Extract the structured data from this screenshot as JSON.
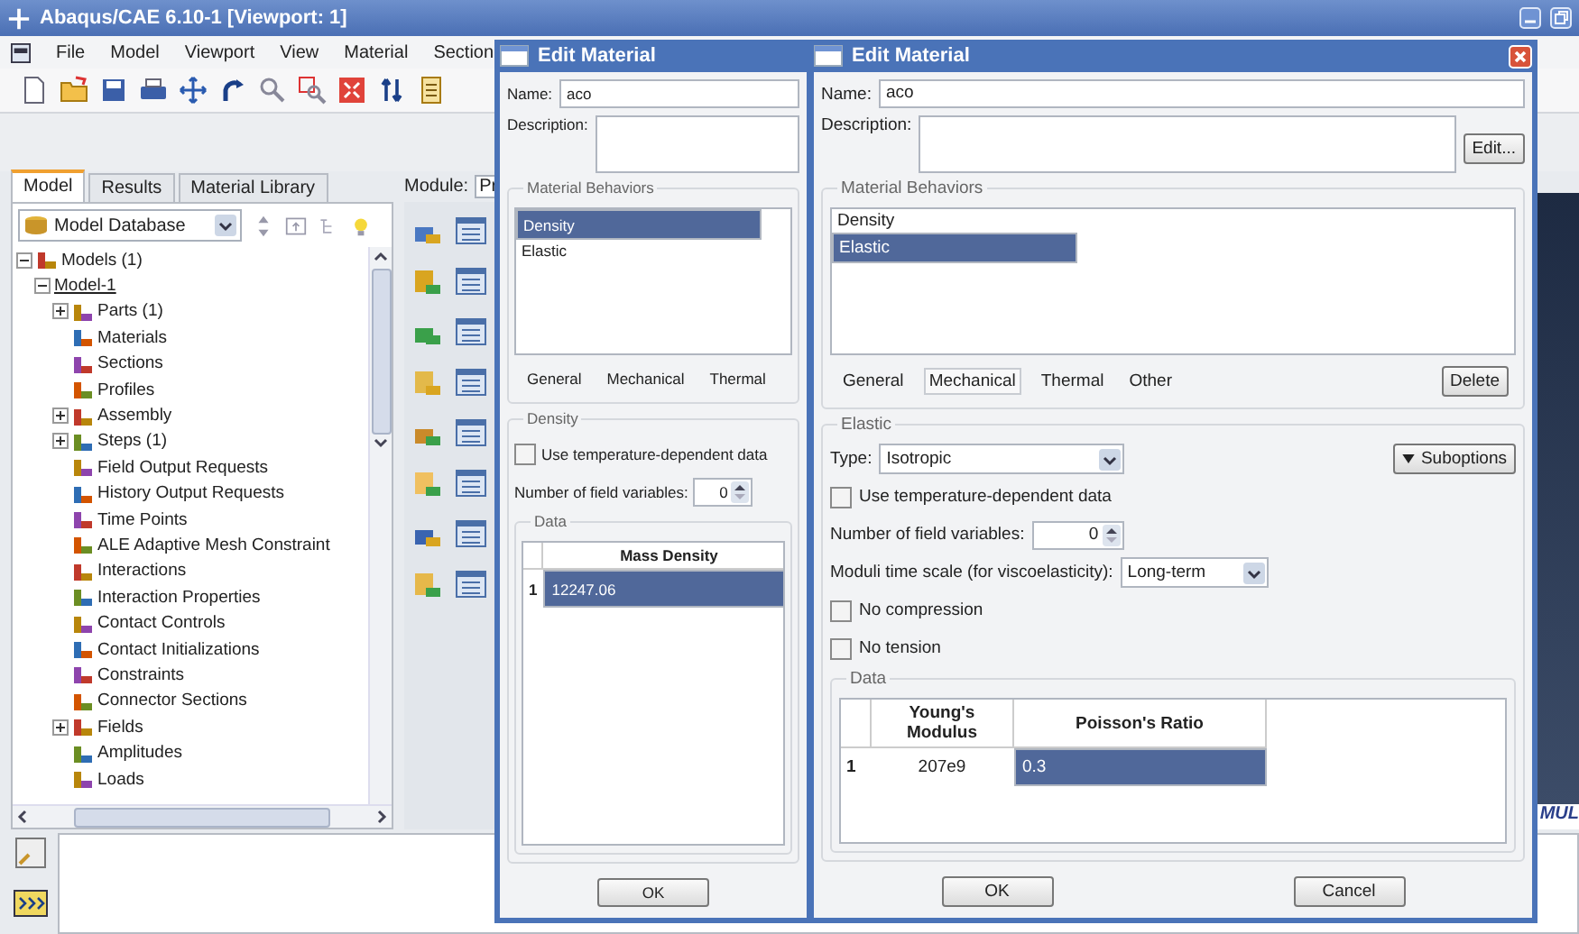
{
  "main_window": {
    "title": "Abaqus/CAE 6.10-1 [Viewport: 1]"
  },
  "menu": [
    "File",
    "Model",
    "Viewport",
    "View",
    "Material",
    "Section"
  ],
  "tabs": [
    {
      "label": "Model",
      "selected": true
    },
    {
      "label": "Results",
      "selected": false
    },
    {
      "label": "Material Library",
      "selected": false
    }
  ],
  "database_select": {
    "value": "Model Database"
  },
  "module": {
    "label": "Module:",
    "value": "Pr"
  },
  "tree": [
    {
      "label": "Models (1)",
      "expanded": true,
      "children": [
        {
          "label": "Model-1",
          "expanded": true,
          "children": [
            {
              "label": "Parts (1)",
              "expanded": false
            },
            {
              "label": "Materials"
            },
            {
              "label": "Sections"
            },
            {
              "label": "Profiles"
            },
            {
              "label": "Assembly",
              "expanded": false
            },
            {
              "label": "Steps (1)",
              "expanded": false
            },
            {
              "label": "Field Output Requests"
            },
            {
              "label": "History Output Requests"
            },
            {
              "label": "Time Points"
            },
            {
              "label": "ALE Adaptive Mesh Constraint"
            },
            {
              "label": "Interactions"
            },
            {
              "label": "Interaction Properties"
            },
            {
              "label": "Contact Controls"
            },
            {
              "label": "Contact Initializations"
            },
            {
              "label": "Constraints"
            },
            {
              "label": "Connector Sections"
            },
            {
              "label": "Fields",
              "expanded": false
            },
            {
              "label": "Amplitudes"
            },
            {
              "label": "Loads"
            }
          ]
        }
      ]
    }
  ],
  "viewport": {
    "logo_text": "MUL"
  },
  "dialogs": [
    {
      "title": "Edit Material",
      "name_label": "Name:",
      "name": "aco",
      "description_label": "Description:",
      "behaviors_title": "Material Behaviors",
      "behaviors": [
        {
          "label": "Density",
          "selected": true
        },
        {
          "label": "Elastic",
          "selected": false
        }
      ],
      "behavior_tabs": [
        {
          "label": "General",
          "selected": false
        },
        {
          "label": "Mechanical",
          "selected": false
        },
        {
          "label": "Thermal",
          "selected": false
        }
      ],
      "section_title": "Density",
      "options": [
        {
          "kind": "checkbox",
          "label": "Use temperature-dependent data",
          "checked": false
        },
        {
          "kind": "spinner",
          "label": "Number of field variables:",
          "value": "0"
        }
      ],
      "data_title": "Data",
      "table": {
        "columns": [
          "Mass Density"
        ],
        "rows": [
          {
            "index": "1",
            "cells": [
              {
                "text": "12247.06",
                "selected": true
              }
            ]
          }
        ]
      },
      "buttons": [
        "OK"
      ]
    },
    {
      "title": "Edit Material",
      "name_label": "Name:",
      "name": "aco",
      "description_label": "Description:",
      "edit_button": "Edit...",
      "behaviors_title": "Material Behaviors",
      "behaviors": [
        {
          "label": "Density",
          "selected": false
        },
        {
          "label": "Elastic",
          "selected": true
        }
      ],
      "behavior_tabs": [
        {
          "label": "General",
          "selected": false
        },
        {
          "label": "Mechanical",
          "selected": true
        },
        {
          "label": "Thermal",
          "selected": false
        },
        {
          "label": "Other",
          "selected": false
        }
      ],
      "delete_button": "Delete",
      "section_title": "Elastic",
      "options": [
        {
          "kind": "select",
          "label": "Type:",
          "value": "Isotropic",
          "button": "Suboptions"
        },
        {
          "kind": "checkbox",
          "label": "Use temperature-dependent data",
          "checked": false
        },
        {
          "kind": "spinner",
          "label": "Number of field variables:",
          "value": "0"
        },
        {
          "kind": "select",
          "label": "Moduli time scale (for viscoelasticity):",
          "value": "Long-term"
        },
        {
          "kind": "checkbox",
          "label": "No compression",
          "checked": false
        },
        {
          "kind": "checkbox",
          "label": "No tension",
          "checked": false
        }
      ],
      "data_title": "Data",
      "table": {
        "columns": [
          "Young's Modulus",
          "Poisson's Ratio"
        ],
        "rows": [
          {
            "index": "1",
            "cells": [
              {
                "text": "207e9",
                "selected": false
              },
              {
                "text": "0.3",
                "selected": true
              }
            ]
          }
        ]
      },
      "buttons": [
        "OK",
        "Cancel"
      ]
    }
  ]
}
